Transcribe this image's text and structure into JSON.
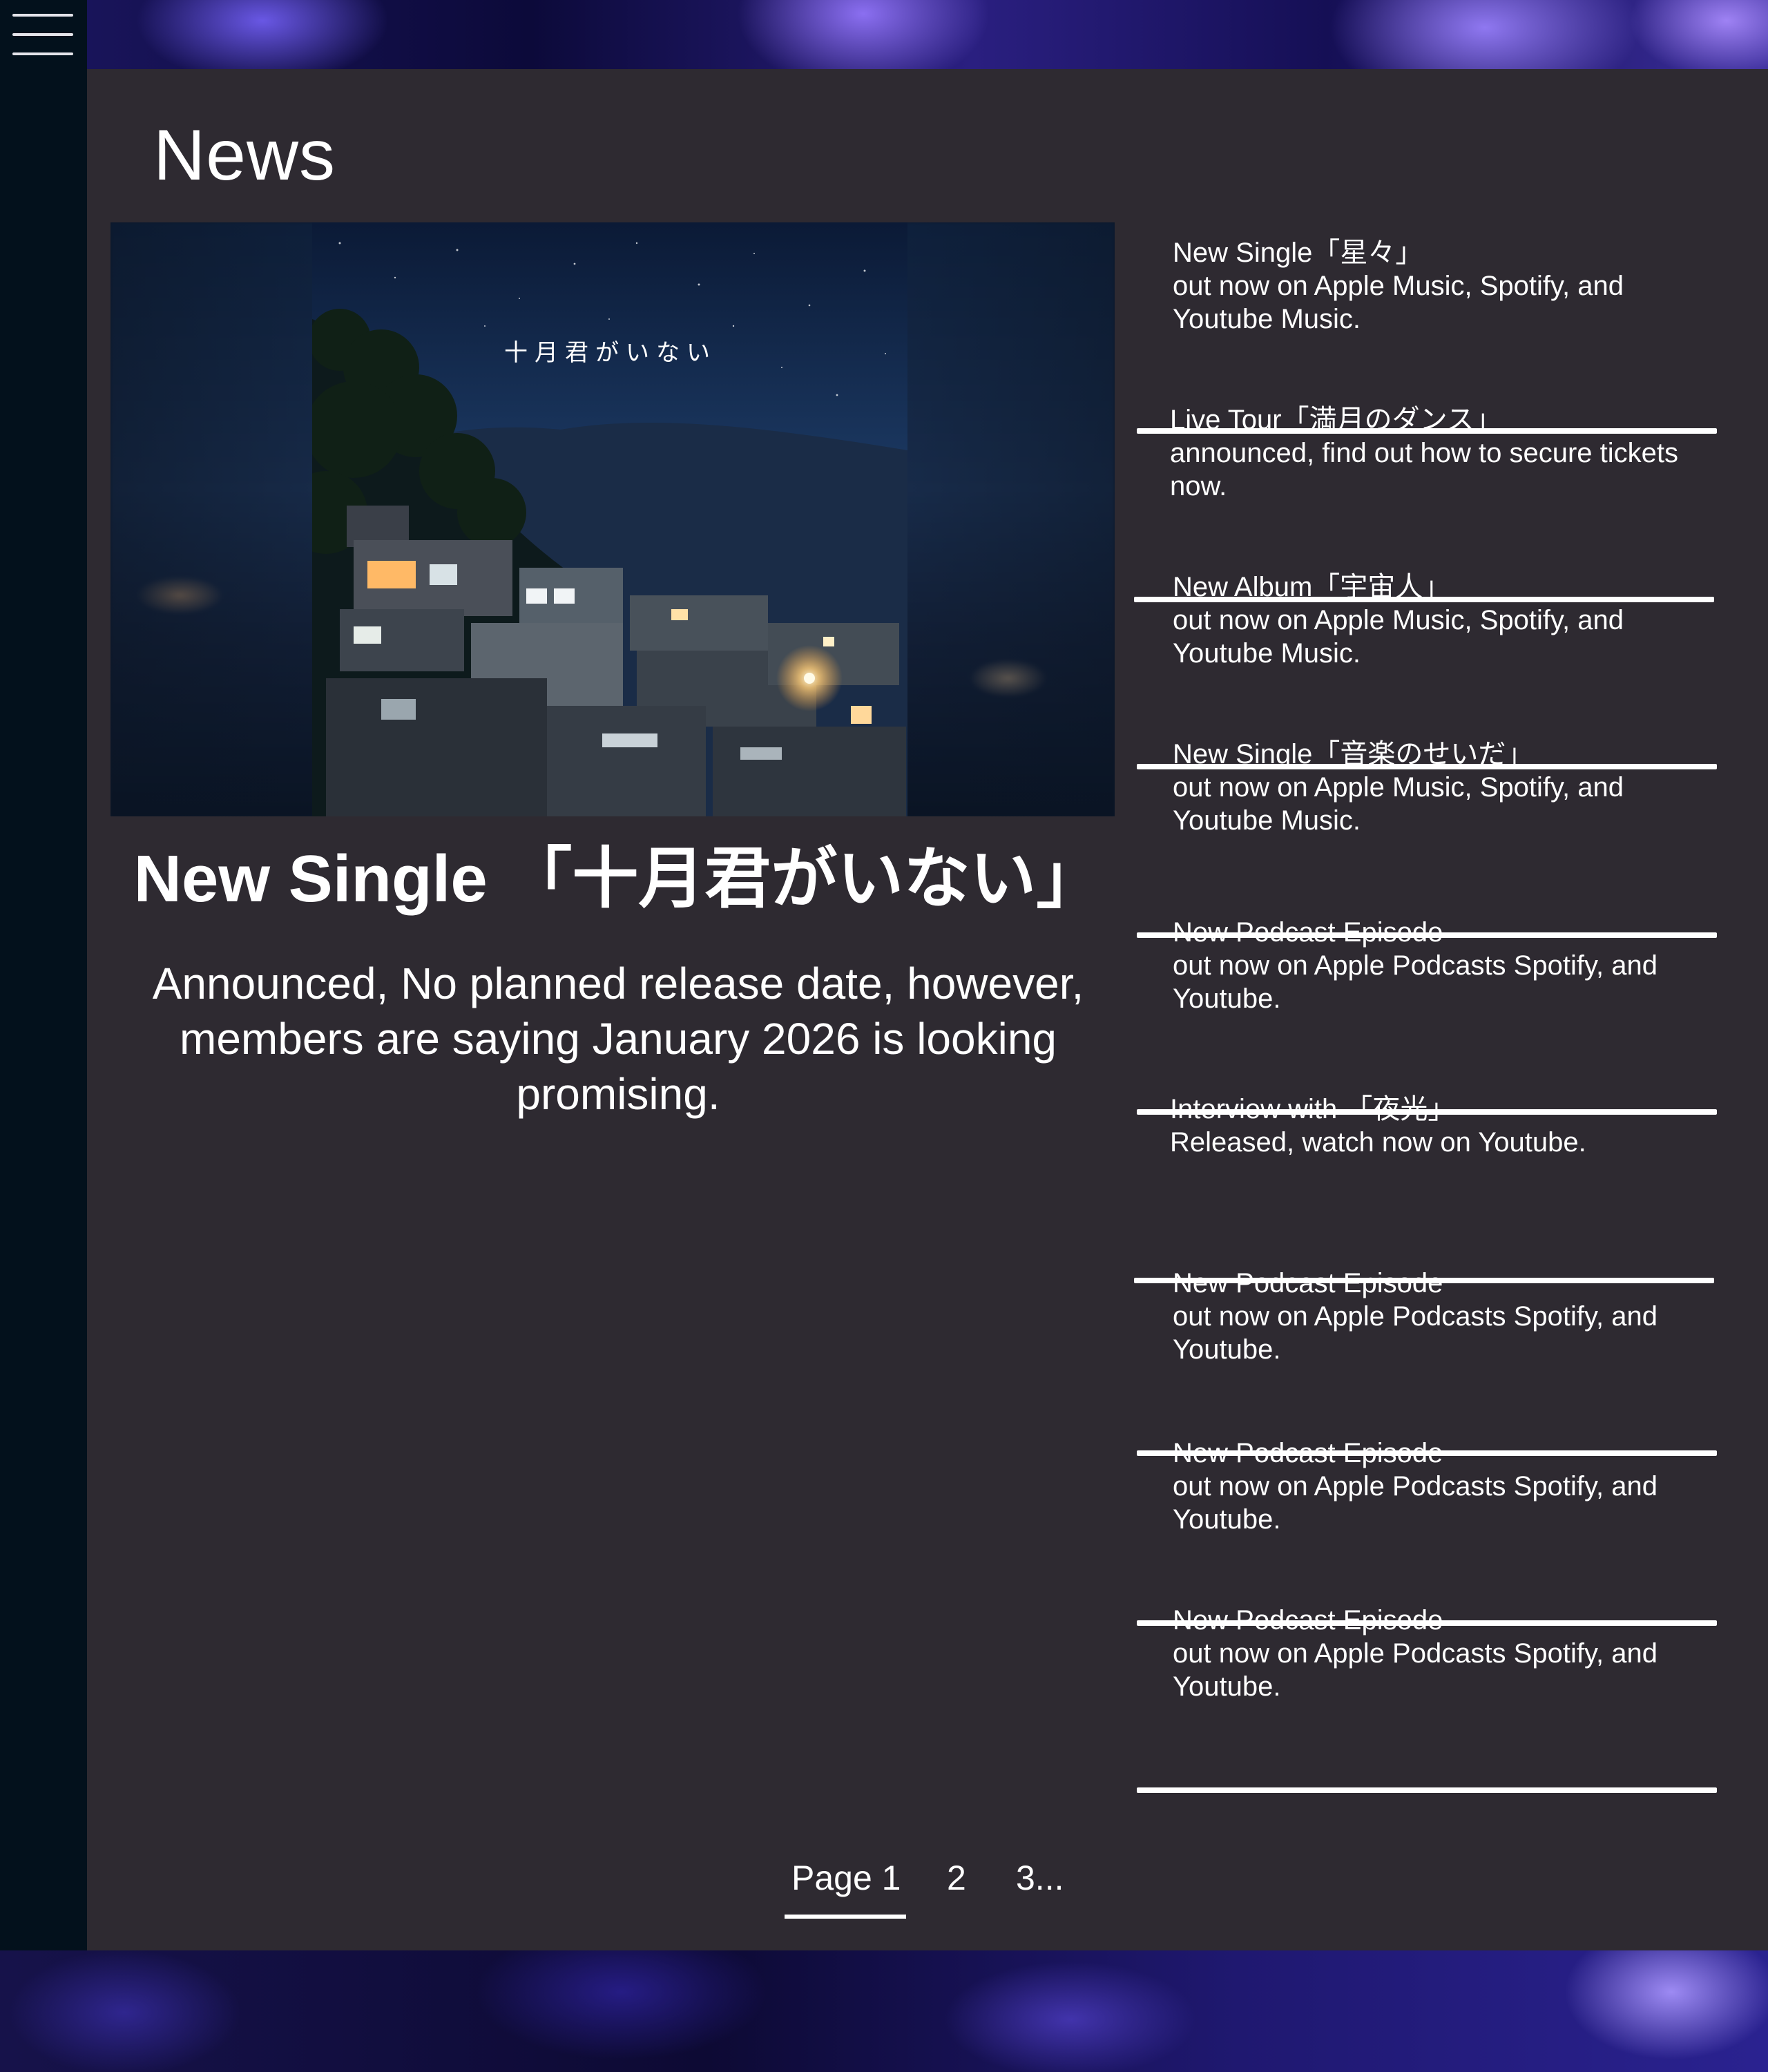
{
  "page": {
    "title": "News"
  },
  "nav": {
    "menu_icon": "hamburger-menu-icon"
  },
  "featured": {
    "image_text": "十月君がいない",
    "title": "New Single 「十月君がいない」",
    "description": "Announced, No planned release date, however, members are saying January 2026 is looking promising."
  },
  "news": [
    {
      "text": "New Single「星々」\nout now on Apple Music, Spotify, and Youtube Music."
    },
    {
      "text": "Live Tour「満月のダンス」\nannounced, find out how to secure tickets now."
    },
    {
      "text": "New Album「宇宙人」\nout now on Apple Music, Spotify, and Youtube Music."
    },
    {
      "text": "New Single「音楽のせいだ」\nout now on Apple Music, Spotify, and Youtube Music."
    },
    {
      "text": "New Podcast Episode\nout now on Apple Podcasts Spotify, and Youtube."
    },
    {
      "text": "Interview with 「夜光」\nReleased, watch now on Youtube."
    },
    {
      "text": "New Podcast Episode\nout now on Apple Podcasts Spotify, and Youtube."
    },
    {
      "text": "New Podcast Episode\nout now on Apple Podcasts Spotify, and Youtube."
    },
    {
      "text": "New Podcast Episode\nout now on Apple Podcasts Spotify, and Youtube."
    }
  ],
  "pagination": {
    "current": "Page 1",
    "page2": "2",
    "more": "3..."
  },
  "colors": {
    "panel": "#2e2a31",
    "sidebar": "#03111c",
    "text": "#ffffff"
  }
}
